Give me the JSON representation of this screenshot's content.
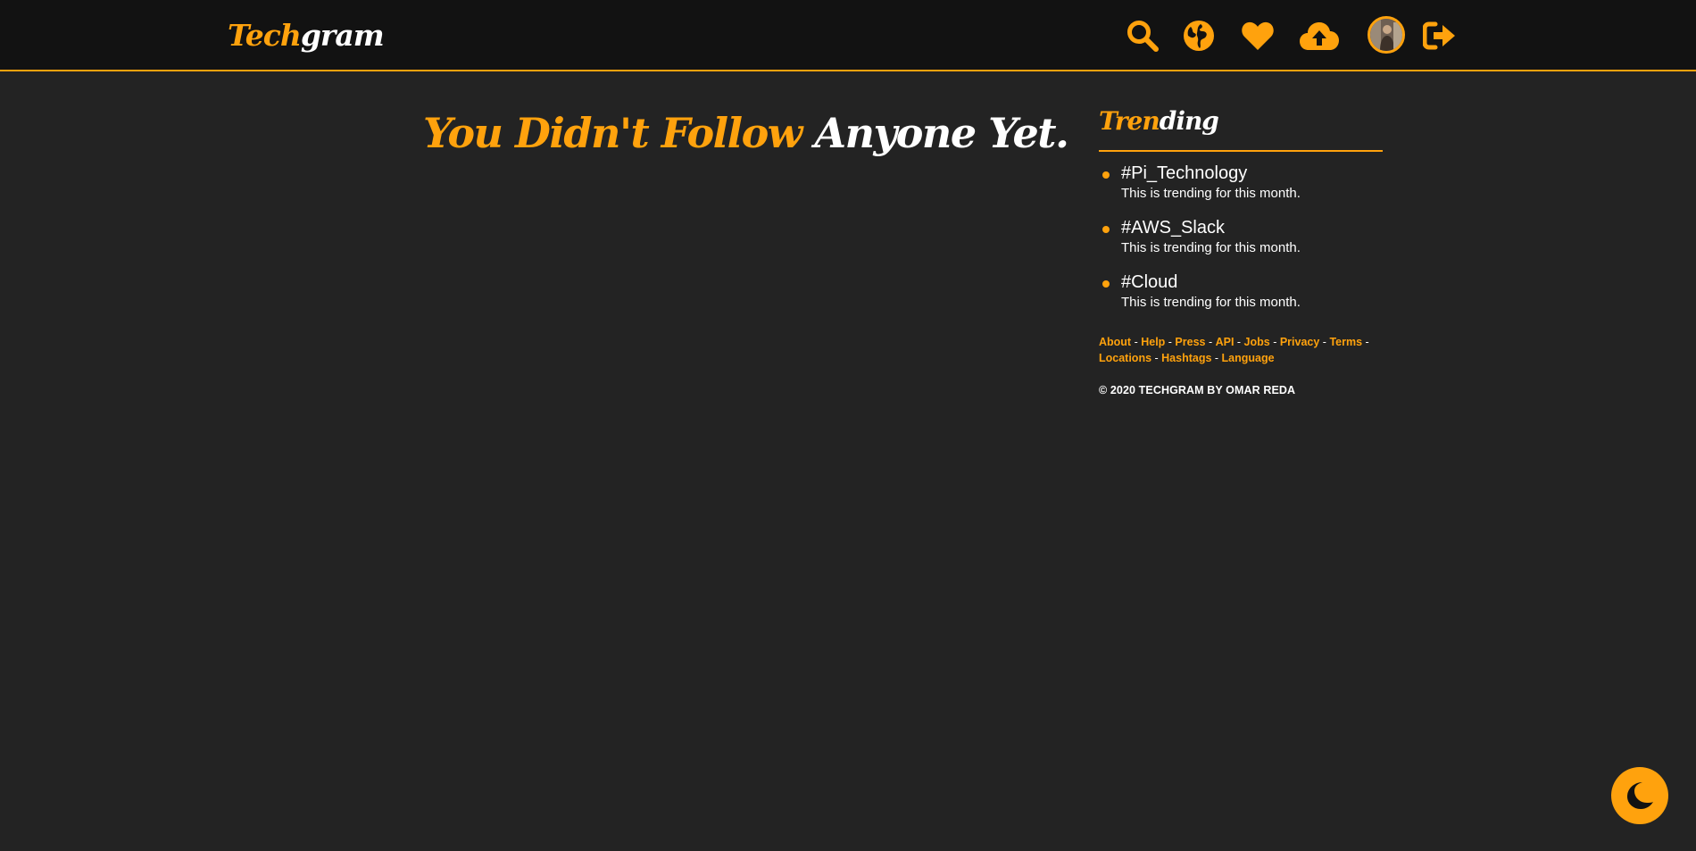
{
  "brand": {
    "logo_part1": "Tech",
    "logo_part2": "gram"
  },
  "nav": {
    "icons": [
      "search-icon",
      "globe-icon",
      "heart-icon",
      "cloud-upload-icon",
      "avatar",
      "sign-out-icon"
    ]
  },
  "main": {
    "heading_part1": "You Didn't Follow",
    "heading_part2": "Anyone Yet."
  },
  "sidebar": {
    "title_part1": "Tren",
    "title_part2": "ding",
    "trends": [
      {
        "tag": "#Pi_Technology",
        "desc": "This is trending for this month."
      },
      {
        "tag": "#AWS_Slack",
        "desc": "This is trending for this month."
      },
      {
        "tag": "#Cloud",
        "desc": "This is trending for this month."
      }
    ],
    "footer_links": [
      "About",
      "Help",
      "Press",
      "API",
      "Jobs",
      "Privacy",
      "Terms",
      "Locations",
      "Hashtags",
      "Language"
    ],
    "copyright": "© 2020 TECHGRAM BY OMAR REDA"
  },
  "theme_toggle": {
    "icon": "moon-icon"
  },
  "colors": {
    "accent": "#ffa20d",
    "navbar_bg": "#121212",
    "page_bg": "#232323",
    "text": "#ffffff"
  }
}
